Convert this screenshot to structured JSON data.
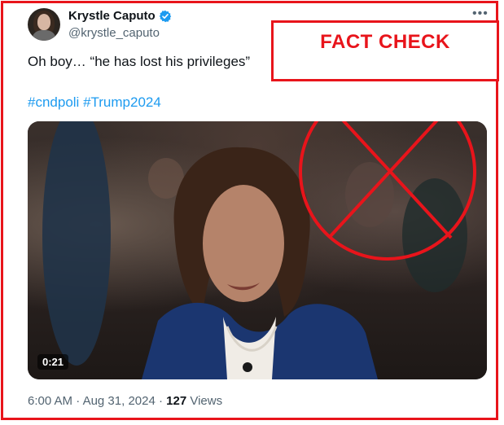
{
  "tweet": {
    "author_name": "Krystle Caputo",
    "author_handle": "@krystle_caputo",
    "more_icon": "more-horizontal-icon",
    "text": "Oh boy… “he has lost his privileges”",
    "hashtags": [
      "#cndpoli",
      "#Trump2024"
    ],
    "video_duration": "0:21",
    "meta": {
      "time": "6:00 AM",
      "separator1": "·",
      "date": "Aug 31, 2024",
      "separator2": "·",
      "views_count": "127",
      "views_label": "Views"
    }
  },
  "overlay": {
    "fact_check_label": "FACT CHECK"
  },
  "colors": {
    "overlay_red": "#e8141b",
    "verified_blue": "#1d9bf0",
    "link_blue": "#1d9bf0",
    "secondary_text": "#536471"
  }
}
